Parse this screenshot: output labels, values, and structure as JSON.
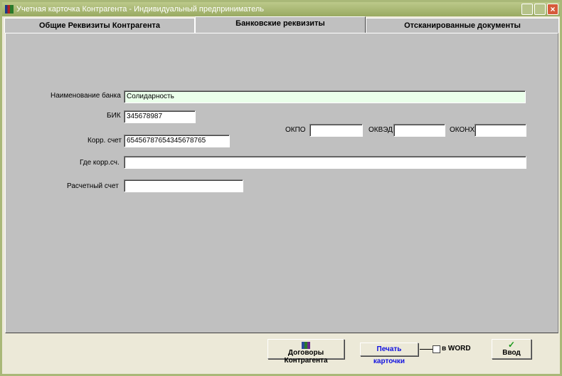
{
  "window": {
    "title": "Учетная карточка Контрагента - Индивидуальный предприниматель"
  },
  "tabs": [
    {
      "label": "Общие Реквизиты Контрагента"
    },
    {
      "label": "Банковские реквизиты",
      "active": true
    },
    {
      "label": "Отсканированные документы"
    }
  ],
  "form": {
    "bank_name": {
      "label": "Наименование банка",
      "value": "Солидарность"
    },
    "bik": {
      "label": "БИК",
      "value": "345678987"
    },
    "corr_account": {
      "label": "Корр. счет",
      "value": "65456787654345678765"
    },
    "okpo": {
      "label": "ОКПО",
      "value": ""
    },
    "okved": {
      "label": "ОКВЭД",
      "value": ""
    },
    "okonh": {
      "label": "ОКОНХ",
      "value": ""
    },
    "corr_where": {
      "label": "Где корр.сч.",
      "value": ""
    },
    "settlement_account": {
      "label": "Расчетный счет",
      "value": ""
    }
  },
  "footer": {
    "contracts_button": "Договоры Контрагента",
    "print_button": "Печать карточки",
    "word_checkbox": "в WORD",
    "word_checked": false,
    "enter_button": "Ввод"
  }
}
